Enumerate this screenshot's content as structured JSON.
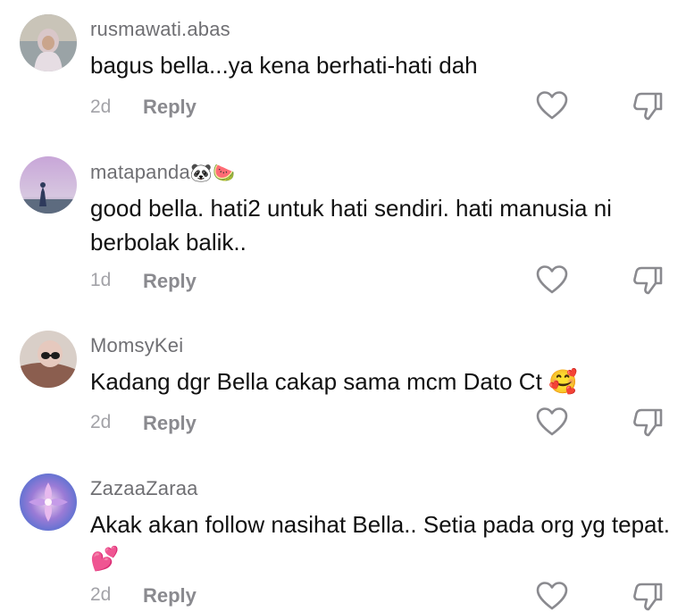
{
  "comments": [
    {
      "username": "rusmawati.abas",
      "username_emoji": "",
      "text": "bagus bella...ya kena berhati-hati dah",
      "text_emoji": "",
      "time": "2d",
      "reply": "Reply"
    },
    {
      "username": "matapanda",
      "username_emoji": "🐼🍉",
      "text": "good bella. hati2 untuk hati sendiri. hati manusia ni berbolak balik..",
      "text_emoji": "",
      "time": "1d",
      "reply": "Reply"
    },
    {
      "username": "MomsyKei",
      "username_emoji": "",
      "text": "Kadang dgr Bella cakap sama mcm Dato Ct",
      "text_emoji": "🥰",
      "time": "2d",
      "reply": "Reply"
    },
    {
      "username": "ZazaaZaraa",
      "username_emoji": "",
      "text": "Akak akan follow nasihat Bella.. Setia pada org yg tepat.",
      "text_emoji": "💕",
      "time": "2d",
      "reply": "Reply"
    }
  ],
  "icons": {
    "like": "heart-outline-icon",
    "dislike": "thumbs-down-outline-icon"
  },
  "colors": {
    "username": "#6f6f73",
    "text": "#111111",
    "meta": "#a3a3a8",
    "icon": "#8a8a8f"
  }
}
